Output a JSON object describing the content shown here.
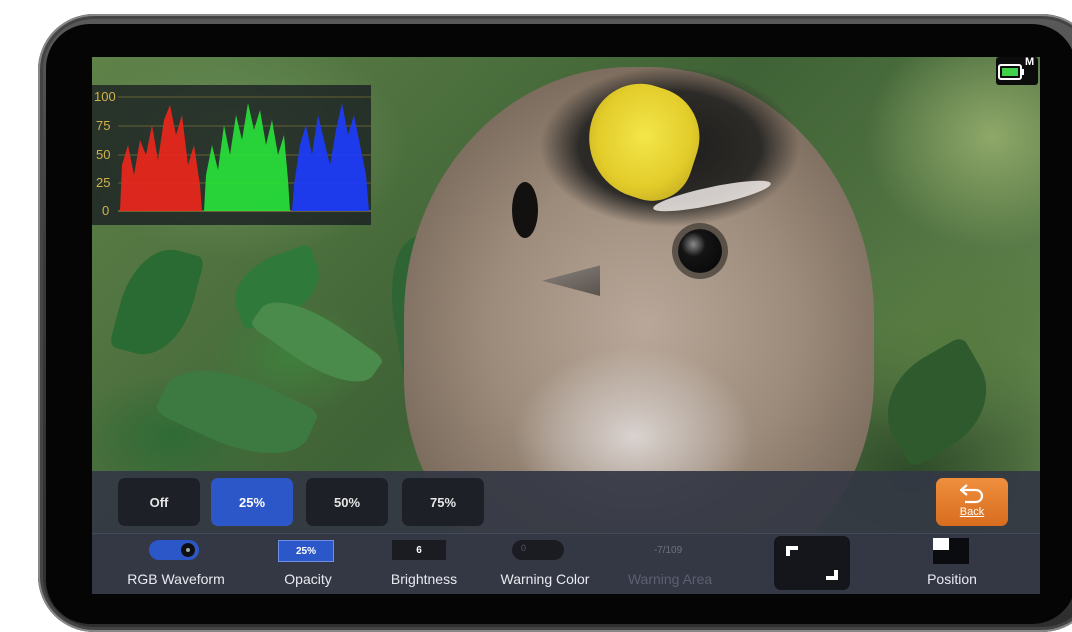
{
  "waveform": {
    "axis_labels": [
      "100",
      "75",
      "50",
      "25",
      "0"
    ]
  },
  "status": {
    "battery_icon": "battery-icon",
    "mode_letter": "M"
  },
  "opacity_options": [
    {
      "label": "Off",
      "active": false
    },
    {
      "label": "25%",
      "active": true
    },
    {
      "label": "50%",
      "active": false
    },
    {
      "label": "75%",
      "active": false
    }
  ],
  "back_button": {
    "label": "Back",
    "icon": "undo-arrow-icon"
  },
  "controls": {
    "rgb_waveform": {
      "label": "RGB Waveform",
      "state": "on"
    },
    "opacity": {
      "label": "Opacity",
      "value": "25%"
    },
    "brightness": {
      "label": "Brightness",
      "value": "6"
    },
    "warning_color": {
      "label": "Warning Color",
      "value": "0"
    },
    "warning_area": {
      "label": "Warning Area",
      "value": "-7/109"
    },
    "frame_select": {
      "icon": "corner-frame-icon"
    },
    "position": {
      "label": "Position",
      "icon": "position-icon"
    }
  },
  "colors": {
    "accent_blue": "#2c57c8",
    "back_orange": "#e27a2a",
    "panel": "#343845"
  }
}
